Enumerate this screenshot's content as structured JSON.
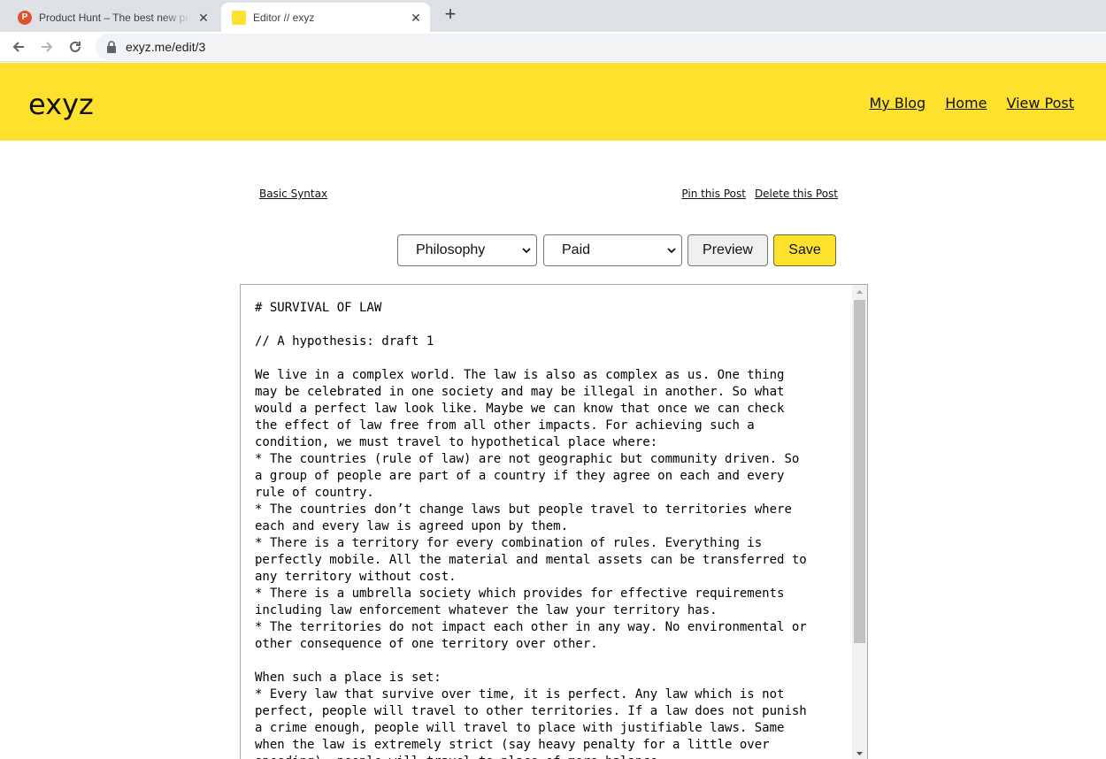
{
  "browser": {
    "tabs": [
      {
        "title": "Product Hunt – The best new products",
        "favicon": "product-hunt-icon",
        "active": false
      },
      {
        "title": "Editor // exyz",
        "favicon": "editor-icon",
        "active": true
      }
    ],
    "url": "exyz.me/edit/3"
  },
  "site": {
    "logo": "exyz",
    "nav": [
      {
        "label": "My Blog"
      },
      {
        "label": "Home"
      },
      {
        "label": "View Post"
      }
    ],
    "accent_color": "#fde12d"
  },
  "editor": {
    "basic_syntax": "Basic Syntax",
    "pin_post": "Pin this Post",
    "delete_post": "Delete this Post",
    "category": "Philosophy",
    "access": "Paid",
    "preview_label": "Preview",
    "save_label": "Save",
    "lines": [
      "# SURVIVAL OF LAW",
      "",
      "// A hypothesis: draft 1",
      "",
      "We live in a complex world. The law is also as complex as us. One thing",
      "may be celebrated in one society and may be illegal in another. So what",
      "would a perfect law look like. Maybe we can know that once we can check",
      "the effect of law free from all other impacts. For achieving such a",
      "condition, we must travel to hypothetical place where:",
      "* The countries (rule of law) are not geographic but community driven. So",
      "a group of people are part of a country if they agree on each and every",
      "rule of country.",
      "* The countries don’t change laws but people travel to territories where",
      "each and every law is agreed upon by them.",
      "* There is a territory for every combination of rules. Everything is",
      "perfectly mobile. All the material and mental assets can be transferred to",
      "any territory without cost.",
      "* There is a umbrella society which provides for effective requirements",
      "including law enforcement whatever the law your territory has.",
      "* The territories do not impact each other in any way. No environmental or",
      "other consequence of one territory over other.",
      "",
      "When such a place is set:",
      "* Every law that survive over time, it is perfect. Any law which is not",
      "perfect, people will travel to other territories. If a law does not punish",
      "a crime enough, people will travel to place with justifiable laws. Same",
      "when the law is extremely strict (say heavy penalty for a little over",
      "speeding), people will travel to place of more balance."
    ]
  }
}
